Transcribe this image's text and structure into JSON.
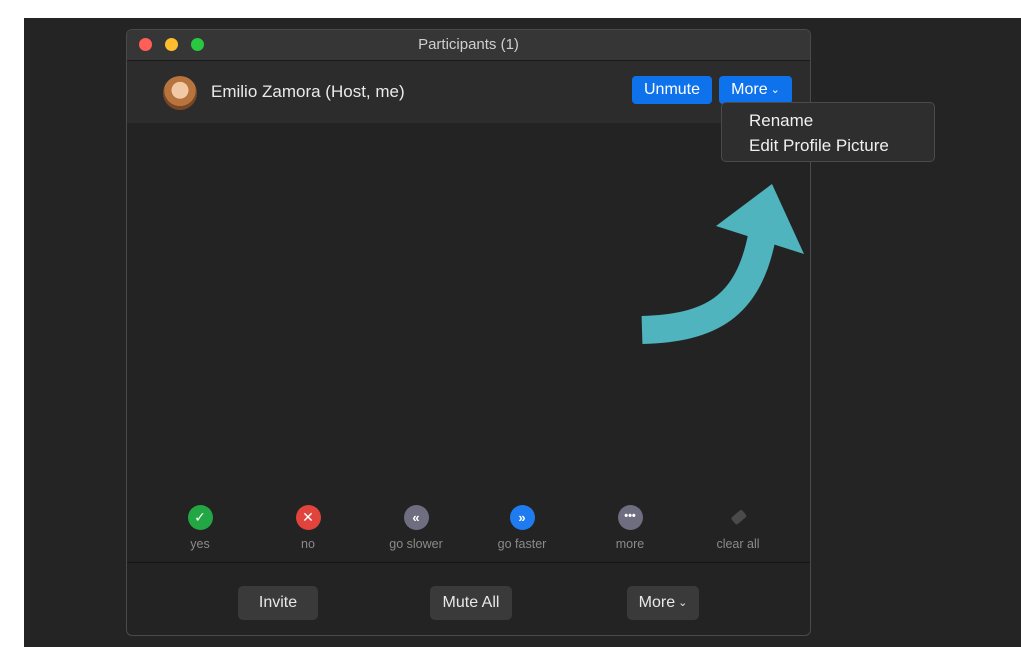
{
  "window": {
    "title": "Participants (1)"
  },
  "participant": {
    "name": "Emilio Zamora (Host, me)",
    "unmute_label": "Unmute",
    "more_label": "More"
  },
  "dropdown": {
    "items": [
      "Rename",
      "Edit Profile Picture"
    ]
  },
  "feedback": [
    {
      "label": "yes",
      "icon": "check-icon",
      "color": "#22a744"
    },
    {
      "label": "no",
      "icon": "x-icon",
      "color": "#e0443c"
    },
    {
      "label": "go slower",
      "icon": "rewind-icon",
      "color": "#6e6e80"
    },
    {
      "label": "go faster",
      "icon": "fast-forward-icon",
      "color": "#1f7cf0"
    },
    {
      "label": "more",
      "icon": "ellipsis-icon",
      "color": "#6e6e80"
    },
    {
      "label": "clear all",
      "icon": "eraser-icon",
      "color": "#3a3a3a"
    }
  ],
  "footer": {
    "invite_label": "Invite",
    "mute_all_label": "Mute All",
    "more_label": "More"
  },
  "colors": {
    "accent": "#0e72ed",
    "arrow": "#4fb4bd"
  }
}
